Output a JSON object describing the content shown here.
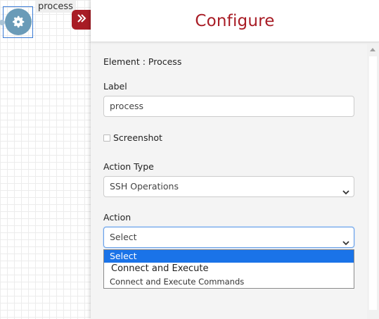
{
  "canvas": {
    "node_label": "process"
  },
  "panel": {
    "title": "Configure",
    "element_text": "Element : Process",
    "label_field": {
      "label": "Label",
      "value": "process"
    },
    "screenshot": {
      "label": "Screenshot",
      "checked": false
    },
    "action_type": {
      "label": "Action Type",
      "value": "SSH Operations"
    },
    "action": {
      "label": "Action",
      "value": "Select",
      "options": [
        {
          "label": "Select",
          "selected": true
        },
        {
          "label": "Connect and Execute",
          "group": true
        },
        {
          "label": "Connect and Execute Commands",
          "group": false
        }
      ]
    }
  },
  "colors": {
    "accent": "#a81c25",
    "highlight": "#1a73e8",
    "node": "#6a9bb8"
  },
  "icons": {
    "node": "gear-icon",
    "collapse": "double-chevron-right-icon",
    "select_arrow": "chevron-down-icon"
  }
}
